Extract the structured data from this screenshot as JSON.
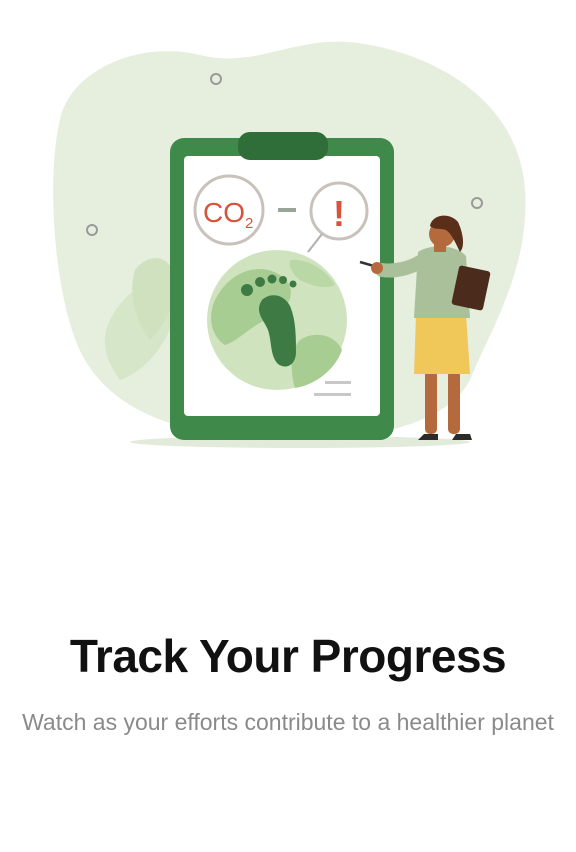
{
  "onboarding": {
    "title": "Track Your Progress",
    "subtitle": "Watch as your efforts contribute to a healthier planet",
    "illustration": {
      "co2_label": "CO",
      "co2_subscript": "2",
      "alert_symbol": "!"
    }
  },
  "colors": {
    "background": "#ffffff",
    "blob": "#e6efdd",
    "clipboard_green": "#3f8a4a",
    "clipboard_dark": "#2f6d39",
    "paper": "#ffffff",
    "globe_light": "#cfe3bf",
    "globe_mid": "#8fbd7a",
    "footprint": "#3d7a44",
    "co2_red": "#d6543c",
    "skirt_yellow": "#f0c85a",
    "shirt_sage": "#a9c09a",
    "skin": "#b46a3c",
    "hair": "#5a2f1a",
    "title_text": "#111111",
    "subtitle_text": "#8a8a8a"
  }
}
